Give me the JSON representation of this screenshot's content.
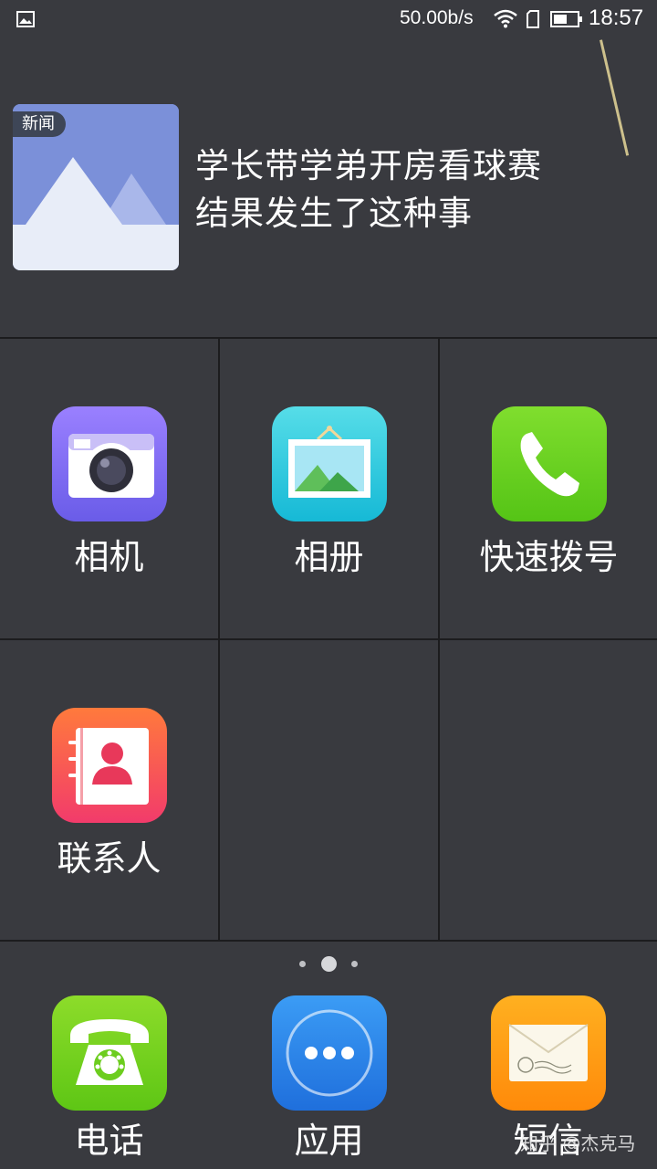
{
  "status_bar": {
    "net_speed": "50.00b/s",
    "time": "18:57",
    "icons": [
      "image-notification-icon",
      "wifi-icon",
      "sim-icon",
      "battery-icon"
    ]
  },
  "news": {
    "tag": "新闻",
    "title_line1": "学长带学弟开房看球赛",
    "title_line2": "结果发生了这种事"
  },
  "apps": [
    {
      "label": "相机",
      "icon": "camera-icon",
      "color": "#7f6cf0"
    },
    {
      "label": "相册",
      "icon": "gallery-icon",
      "color": "#2ec9e0"
    },
    {
      "label": "快速拨号",
      "icon": "speed-dial-icon",
      "color": "#66d123"
    },
    {
      "label": "联系人",
      "icon": "contacts-icon",
      "color": "#f5455f"
    }
  ],
  "page_indicator": {
    "pages": 3,
    "current": 2
  },
  "dock": [
    {
      "label": "电话",
      "icon": "phone-icon",
      "color": "#6fcf1f"
    },
    {
      "label": "应用",
      "icon": "apps-icon",
      "color": "#2f86e8"
    },
    {
      "label": "短信",
      "icon": "sms-icon",
      "color": "#ff9b12"
    }
  ],
  "watermark": "知乎 @杰克马"
}
